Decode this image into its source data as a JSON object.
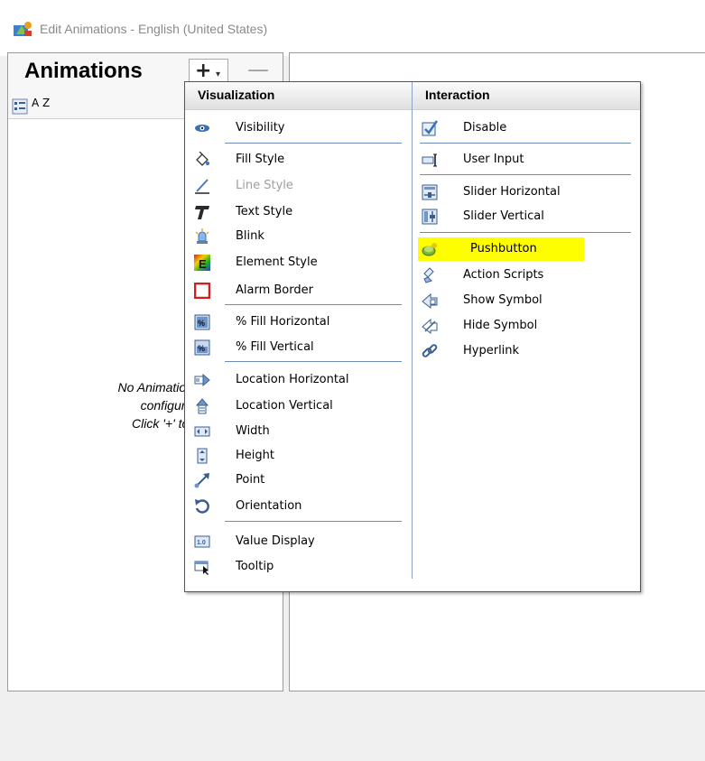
{
  "window": {
    "title": "Edit Animations - English (United States)"
  },
  "animations_panel": {
    "heading": "Animations",
    "add_symbol": "+",
    "add_dropdown_glyph": "▾",
    "remove_symbol": "—",
    "sort_az_label": "A Z",
    "empty_message_line1": "No Animations",
    "empty_message_line2": "configured",
    "empty_message_line3": "Click '+' to a"
  },
  "menu": {
    "visualization": {
      "header": "Visualization",
      "items": [
        {
          "label": "Visibility",
          "icon": "eye-icon"
        },
        {
          "label": "Fill Style",
          "icon": "paint-bucket-icon"
        },
        {
          "label": "Line Style",
          "icon": "pen-icon",
          "disabled": true
        },
        {
          "label": "Text Style",
          "icon": "text-t-icon"
        },
        {
          "label": "Blink",
          "icon": "beacon-icon"
        },
        {
          "label": "Element Style",
          "icon": "element-e-icon"
        },
        {
          "label": "Alarm Border",
          "icon": "alarm-border-icon"
        },
        {
          "label": "% Fill Horizontal",
          "icon": "percent-fill-h-icon"
        },
        {
          "label": "% Fill Vertical",
          "icon": "percent-fill-v-icon"
        },
        {
          "label": "Location Horizontal",
          "icon": "arrow-right-icon"
        },
        {
          "label": "Location Vertical",
          "icon": "arrow-up-icon"
        },
        {
          "label": "Width",
          "icon": "width-icon"
        },
        {
          "label": "Height",
          "icon": "height-icon"
        },
        {
          "label": "Point",
          "icon": "point-icon"
        },
        {
          "label": "Orientation",
          "icon": "rotate-icon"
        },
        {
          "label": "Value Display",
          "icon": "value-display-icon"
        },
        {
          "label": "Tooltip",
          "icon": "tooltip-icon"
        }
      ]
    },
    "interaction": {
      "header": "Interaction",
      "items": [
        {
          "label": "Disable",
          "icon": "checkbox-icon"
        },
        {
          "label": "User Input",
          "icon": "input-icon"
        },
        {
          "label": "Slider Horizontal",
          "icon": "slider-h-icon"
        },
        {
          "label": "Slider Vertical",
          "icon": "slider-v-icon"
        },
        {
          "label": "Pushbutton",
          "icon": "pushbutton-icon",
          "highlighted": true
        },
        {
          "label": "Action Scripts",
          "icon": "script-icon"
        },
        {
          "label": "Show Symbol",
          "icon": "show-symbol-icon"
        },
        {
          "label": "Hide Symbol",
          "icon": "hide-symbol-icon"
        },
        {
          "label": "Hyperlink",
          "icon": "link-icon"
        }
      ]
    }
  },
  "colors": {
    "highlight": "#fefe00",
    "separator": "#6b8cba"
  }
}
